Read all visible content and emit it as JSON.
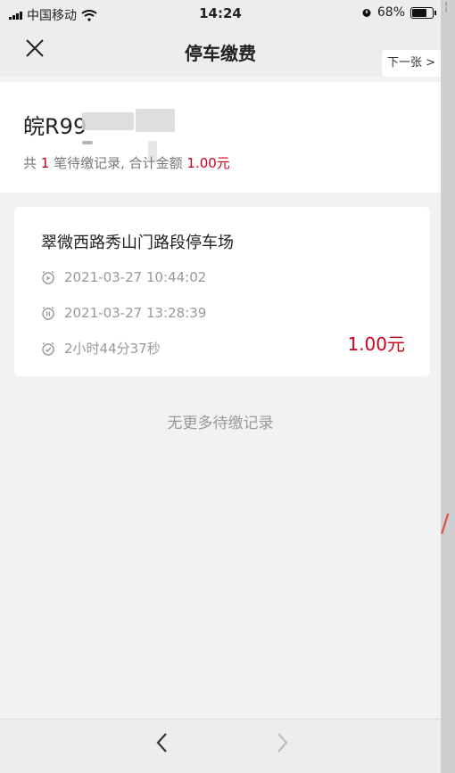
{
  "status_bar": {
    "carrier": "中国移动",
    "time": "14:24",
    "battery": "68%",
    "battery_level": 0.68
  },
  "nav": {
    "close_icon": "close-icon",
    "title": "停车缴费",
    "next_label": "下一张 >"
  },
  "plate": {
    "number": "皖R99",
    "summary_prefix": "共 ",
    "summary_count": "1",
    "summary_mid": " 笔待缴记录, 合计金额 ",
    "summary_amount": "1.00元"
  },
  "record": {
    "lot_name": "翠微西路秀山门路段停车场",
    "start_time": "2021-03-27 10:44:02",
    "end_time": "2021-03-27 13:28:39",
    "duration": "2小时44分37秒",
    "amount": "1.00元"
  },
  "footer_note": "无更多待缴记录",
  "bottom_bar": {
    "back_icon": "chevron-left-icon",
    "forward_icon": "chevron-right-icon"
  },
  "colors": {
    "accent_red": "#d0021b",
    "gray_text": "#999999"
  }
}
